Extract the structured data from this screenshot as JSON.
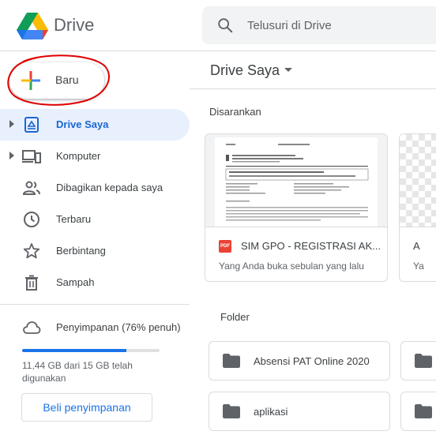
{
  "header": {
    "app_title": "Drive",
    "search_placeholder": "Telusuri di Drive",
    "search_value": ""
  },
  "sidebar": {
    "new_button_label": "Baru",
    "items": [
      {
        "label": "Drive Saya",
        "icon": "my-drive-icon",
        "expandable": true,
        "active": true
      },
      {
        "label": "Komputer",
        "icon": "computer-icon",
        "expandable": true,
        "active": false
      },
      {
        "label": "Dibagikan kepada saya",
        "icon": "shared-people-icon",
        "expandable": false,
        "active": false
      },
      {
        "label": "Terbaru",
        "icon": "clock-icon",
        "expandable": false,
        "active": false
      },
      {
        "label": "Berbintang",
        "icon": "star-icon",
        "expandable": false,
        "active": false
      },
      {
        "label": "Sampah",
        "icon": "trash-icon",
        "expandable": false,
        "active": false
      }
    ],
    "storage": {
      "label": "Penyimpanan (76% penuh)",
      "used_fraction": 0.76,
      "detail": "11,44 GB dari 15 GB telah digunakan",
      "buy_label": "Beli penyimpanan",
      "icon": "cloud-icon"
    }
  },
  "main": {
    "title": "Drive Saya",
    "suggested_label": "Disarankan",
    "suggested_files": [
      {
        "name": "SIM GPO - REGISTRASI AK...",
        "subtitle": "Yang Anda buka sebulan yang lalu",
        "type": "PDF"
      },
      {
        "name": "A",
        "subtitle": "Ya",
        "type": "image"
      }
    ],
    "folder_label": "Folder",
    "folders": [
      {
        "name": "Absensi PAT Online 2020"
      },
      {
        "name": ""
      },
      {
        "name": "aplikasi"
      },
      {
        "name": ""
      }
    ]
  },
  "colors": {
    "accent": "#1a73e8",
    "active_bg": "#e8f0fe",
    "active_text": "#1967d2",
    "annotation": "#e00000",
    "pdf_red": "#ea4335"
  }
}
